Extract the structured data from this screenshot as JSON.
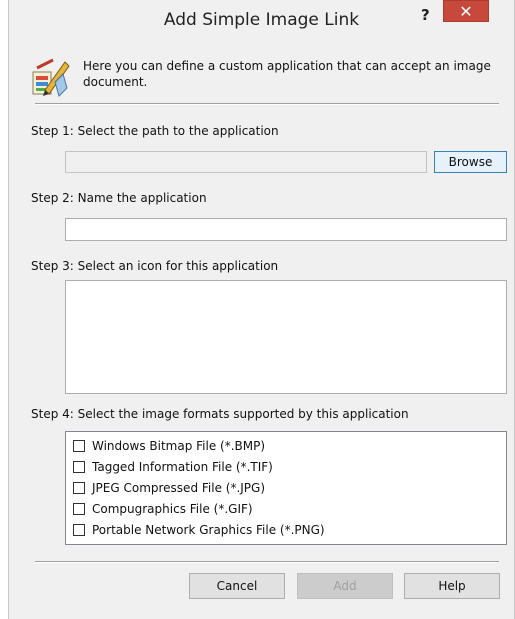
{
  "dialog": {
    "title": "Add Simple Image Link",
    "help_glyph": "?",
    "close_glyph": "✕"
  },
  "intro": {
    "text": "Here you can define a custom application that can accept an image document.",
    "icon": "application-paint-icon"
  },
  "step1": {
    "label": "Step 1: Select the path to the application",
    "path_value": "",
    "browse_label": "Browse"
  },
  "step2": {
    "label": "Step 2: Name the application",
    "name_value": ""
  },
  "step3": {
    "label": "Step 3: Select an icon for this application"
  },
  "step4": {
    "label": "Step 4: Select the image formats supported by this application",
    "formats": [
      {
        "label": "Windows Bitmap File (*.BMP)",
        "checked": false
      },
      {
        "label": "Tagged Information File (*.TIF)",
        "checked": false
      },
      {
        "label": "JPEG Compressed File (*.JPG)",
        "checked": false
      },
      {
        "label": "Compugraphics File (*.GIF)",
        "checked": false
      },
      {
        "label": "Portable Network Graphics File (*.PNG)",
        "checked": false
      }
    ]
  },
  "footer": {
    "cancel_label": "Cancel",
    "add_label": "Add",
    "help_label": "Help"
  },
  "colors": {
    "close_button": "#c7493b",
    "dialog_background": "#f0f0f0"
  }
}
